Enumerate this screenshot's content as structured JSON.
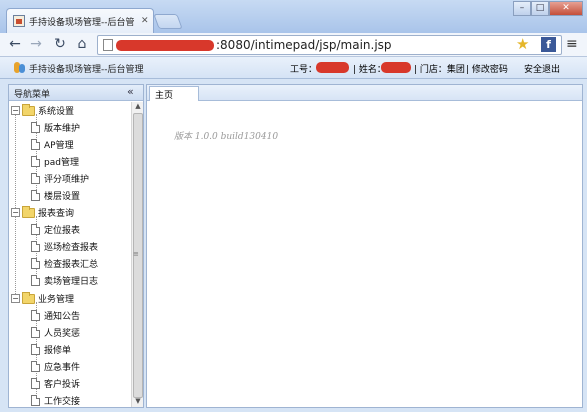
{
  "browser": {
    "tab_title": "手持设备现场管理--后台管",
    "tab_close": "✕",
    "url": ":8080/intimepad/jsp/main.jsp",
    "window_controls": {
      "minimize": "–",
      "maximize": "□",
      "close": "✕"
    }
  },
  "header": {
    "app_title": "手持设备现场管理--后台管理",
    "employee_id_label": "工号：",
    "user_name_label": "| 姓名：",
    "store_label": "| 门店：集团",
    "change_password": "| 修改密码",
    "logout": "安全退出"
  },
  "nav": {
    "title": "导航菜单",
    "collapse_icon": "«",
    "groups": [
      {
        "label": "系统设置",
        "items": [
          "版本维护",
          "AP管理",
          "pad管理",
          "评分项维护",
          "楼层设置"
        ]
      },
      {
        "label": "报表查询",
        "items": [
          "定位报表",
          "巡场检查报表",
          "检查报表汇总",
          "卖场管理日志"
        ]
      },
      {
        "label": "业务管理",
        "items": [
          "通知公告",
          "人员奖惩",
          "报修单",
          "应急事件",
          "客户投诉",
          "工作交接"
        ]
      }
    ]
  },
  "main": {
    "tab_home": "主页",
    "version_text": "版本 1.0.0 build130410"
  },
  "colors": {
    "redaction": "#d8382b",
    "accent": "#a7bcd9"
  }
}
